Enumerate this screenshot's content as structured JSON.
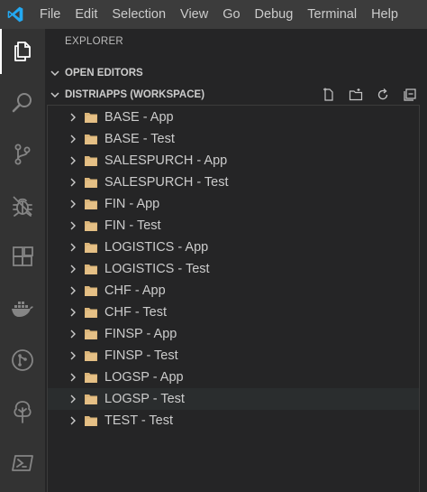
{
  "menu": [
    "File",
    "Edit",
    "Selection",
    "View",
    "Go",
    "Debug",
    "Terminal",
    "Help"
  ],
  "activity": [
    "files-icon",
    "search-icon",
    "source-control-icon",
    "debug-icon",
    "extensions-icon",
    "docker-icon",
    "git-graph-icon",
    "tree-icon",
    "powershell-icon"
  ],
  "explorer": {
    "title": "EXPLORER",
    "open_editors": "OPEN EDITORS",
    "workspace": "DISTRIAPPS (WORKSPACE)"
  },
  "folders": [
    "BASE - App",
    "BASE - Test",
    "SALESPURCH - App",
    "SALESPURCH - Test",
    "FIN - App",
    "FIN - Test",
    "LOGISTICS - App",
    "LOGISTICS - Test",
    "CHF - App",
    "CHF - Test",
    "FINSP - App",
    "FINSP - Test",
    "LOGSP - App",
    "LOGSP - Test",
    "TEST - Test"
  ],
  "colors": {
    "accent": "#0078d4",
    "folder": "#dcb67a",
    "background": "#252526",
    "activitybar": "#333333",
    "titlebar": "#3c3c3c"
  }
}
